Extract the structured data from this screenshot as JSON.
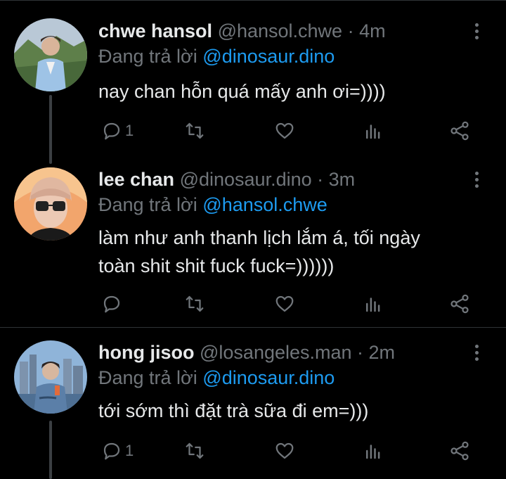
{
  "colors": {
    "background": "#000000",
    "text": "#e7e9ea",
    "muted": "#71767b",
    "accent": "#1d9bf0",
    "separator": "#2f3336"
  },
  "tweets": [
    {
      "name": "chwe hansol",
      "handle": "@hansol.chwe",
      "time": "· 4m",
      "reply_prefix": "Đang trả lời",
      "reply_to": "@dinosaur.dino",
      "text_lines": [
        "nay chan hỗn quá mấy anh ơi=))))"
      ],
      "reply_count": "1",
      "avatar": "person-outdoor-mountain-avatar"
    },
    {
      "name": "lee chan",
      "handle": "@dinosaur.dino",
      "time": "· 3m",
      "reply_prefix": "Đang trả lời",
      "reply_to": "@hansol.chwe",
      "text_lines": [
        "làm như anh thanh lịch lắm á, tối ngày",
        "toàn shit shit fuck fuck=))))))"
      ],
      "reply_count": "",
      "avatar": "person-glasses-avatar"
    },
    {
      "name": "hong jisoo",
      "handle": "@losangeles.man",
      "time": "· 2m",
      "reply_prefix": "Đang trả lời",
      "reply_to": "@dinosaur.dino",
      "text_lines": [
        "tới sớm thì đặt trà sữa đi em=)))"
      ],
      "reply_count": "1",
      "avatar": "person-city-avatar"
    }
  ]
}
